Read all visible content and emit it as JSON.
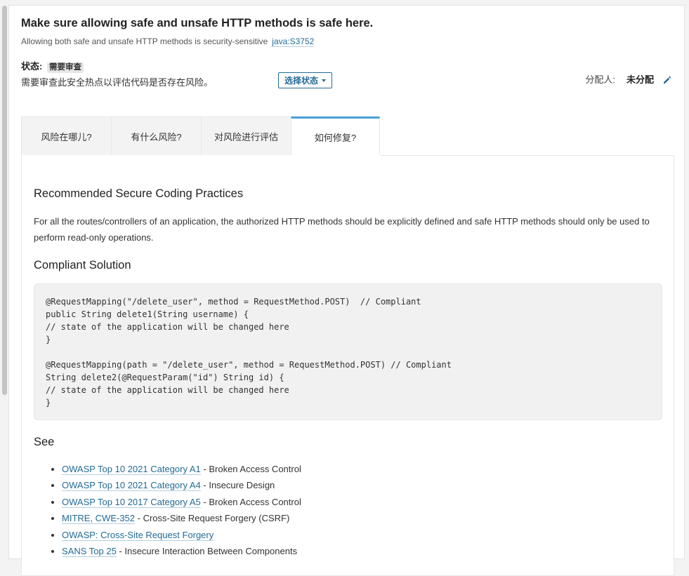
{
  "header": {
    "title": "Make sure allowing safe and unsafe HTTP methods is safe here.",
    "subtitle": "Allowing both safe and unsafe HTTP methods is security-sensitive",
    "rule_key": "java:S3752"
  },
  "status": {
    "label": "状态:",
    "value": "需要审查",
    "description": "需要审查此安全热点以评估代码是否存在风险。",
    "select_label": "选择状态"
  },
  "assignee": {
    "label": "分配人:",
    "value": "未分配"
  },
  "tabs": [
    {
      "label": "风险在哪儿?"
    },
    {
      "label": "有什么风险?"
    },
    {
      "label": "对风险进行评估"
    },
    {
      "label": "如何修复?"
    }
  ],
  "content": {
    "heading1": "Recommended Secure Coding Practices",
    "paragraph": "For all the routes/controllers of an application, the authorized HTTP methods should be explicitly defined and safe HTTP methods should only be used to perform read-only operations.",
    "heading2": "Compliant Solution",
    "code": "@RequestMapping(\"/delete_user\", method = RequestMethod.POST)  // Compliant\npublic String delete1(String username) {\n// state of the application will be changed here\n}\n\n@RequestMapping(path = \"/delete_user\", method = RequestMethod.POST) // Compliant\nString delete2(@RequestParam(\"id\") String id) {\n// state of the application will be changed here\n}",
    "heading3": "See",
    "links": [
      {
        "link": "OWASP Top 10 2021 Category A1",
        "text": " - Broken Access Control"
      },
      {
        "link": "OWASP Top 10 2021 Category A4",
        "text": " - Insecure Design"
      },
      {
        "link": "OWASP Top 10 2017 Category A5",
        "text": " - Broken Access Control"
      },
      {
        "link": "MITRE, CWE-352",
        "text": " - Cross-Site Request Forgery (CSRF)"
      },
      {
        "link": "OWASP: Cross-Site Request Forgery",
        "text": ""
      },
      {
        "link": "SANS Top 25",
        "text": " - Insecure Interaction Between Components"
      }
    ]
  },
  "colors": {
    "link": "#236a97",
    "active_tab_accent": "#4b9fd5",
    "code_background": "#f1f1f1"
  },
  "icons": {
    "assign": "pencil-icon",
    "dropdown": "caret-down-icon"
  }
}
